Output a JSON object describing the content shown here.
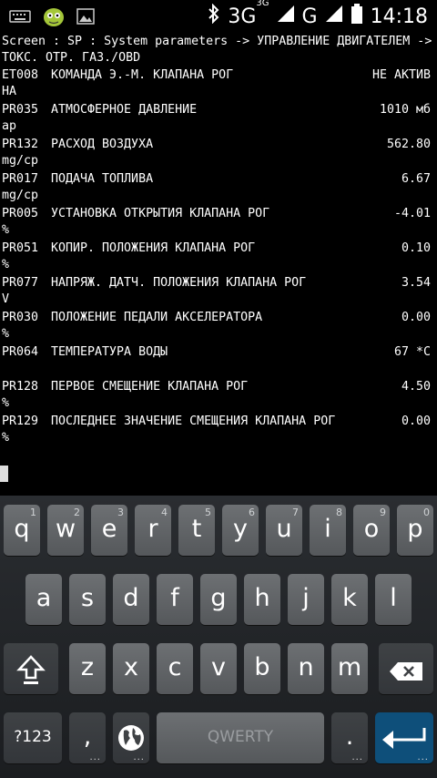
{
  "status": {
    "network": "3G",
    "network_small": "3G",
    "network2": "G",
    "time": "14:18"
  },
  "terminal": {
    "line1": "Screen : SP : System parameters -> УПРАВЛЕНИЕ ДВИГАТЕЛЕМ ->",
    "line2": "ТОКС. ОТР. ГАЗ./OBD",
    "rows": [
      {
        "code": "ET008",
        "name": "КОМАНДА Э.-М. КЛАПАНА РОГ",
        "value": "НЕ АКТИВ",
        "unit": "НА"
      },
      {
        "code": "PR035",
        "name": "АТМОСФЕРНОЕ ДАВЛЕНИЕ",
        "value": "1010 мб",
        "unit": "ар"
      },
      {
        "code": "PR132",
        "name": "РАСХОД ВОЗДУХА",
        "value": "562.80",
        "unit": "mg/ср"
      },
      {
        "code": "PR017",
        "name": "ПОДАЧА ТОПЛИВА",
        "value": "6.67",
        "unit": "mg/ср"
      },
      {
        "code": "PR005",
        "name": "УСТАНОВКА ОТКРЫТИЯ КЛАПАНА РОГ",
        "value": "-4.01",
        "unit": "%"
      },
      {
        "code": "PR051",
        "name": "КОПИР. ПОЛОЖЕНИЯ КЛАПАНА РОГ",
        "value": "0.10",
        "unit": "%"
      },
      {
        "code": "PR077",
        "name": "НАПРЯЖ. ДАТЧ. ПОЛОЖЕНИЯ КЛАПАНА РОГ",
        "value": "3.54",
        "unit": "V"
      },
      {
        "code": "PR030",
        "name": "ПОЛОЖЕНИЕ ПЕДАЛИ АКСЕЛЕРАТОРА",
        "value": "0.00",
        "unit": "%"
      },
      {
        "code": "PR064",
        "name": "ТЕМПЕРАТУРА ВОДЫ",
        "value": "67 *С",
        "unit": ""
      },
      {
        "code": "PR128",
        "name": "ПЕРВОЕ СМЕЩЕНИЕ КЛАПАНА РОГ",
        "value": "4.50",
        "unit": "%"
      },
      {
        "code": "PR129",
        "name": "ПОСЛЕДНЕЕ ЗНАЧЕНИЕ СМЕЩЕНИЯ КЛАПАНА РОГ",
        "value": "0.00",
        "unit": "%"
      }
    ]
  },
  "keyboard": {
    "row1": [
      {
        "label": "q",
        "hint": "1"
      },
      {
        "label": "w",
        "hint": "2"
      },
      {
        "label": "e",
        "hint": "3"
      },
      {
        "label": "r",
        "hint": "4"
      },
      {
        "label": "t",
        "hint": "5"
      },
      {
        "label": "y",
        "hint": "6"
      },
      {
        "label": "u",
        "hint": "7"
      },
      {
        "label": "i",
        "hint": "8"
      },
      {
        "label": "o",
        "hint": "9"
      },
      {
        "label": "p",
        "hint": "0"
      }
    ],
    "row2": [
      "a",
      "s",
      "d",
      "f",
      "g",
      "h",
      "j",
      "k",
      "l"
    ],
    "row3": [
      "z",
      "x",
      "c",
      "v",
      "b",
      "n",
      "m"
    ],
    "symbols_label": "?123",
    "comma_label": ",",
    "space_label": "QWERTY",
    "period_label": ".",
    "icons": {
      "shift": "shift-icon",
      "backspace": "backspace-icon",
      "globe": "globe-icon",
      "enter": "enter-icon"
    }
  }
}
